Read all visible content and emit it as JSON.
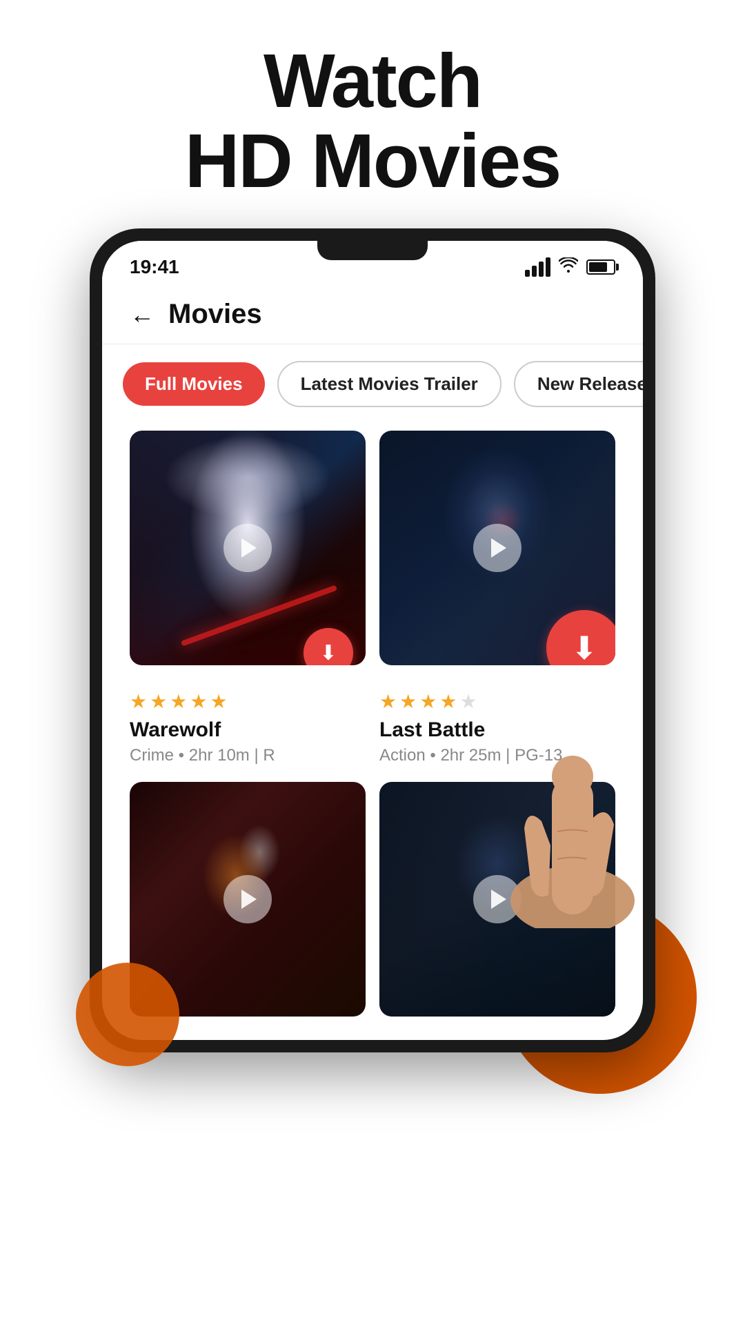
{
  "hero": {
    "title_line1": "Watch",
    "title_line2": "HD Movies"
  },
  "status_bar": {
    "time": "19:41"
  },
  "header": {
    "back_label": "←",
    "title": "Movies"
  },
  "tabs": [
    {
      "id": "full-movies",
      "label": "Full Movies",
      "active": true
    },
    {
      "id": "latest-trailer",
      "label": "Latest Movies Trailer",
      "active": false
    },
    {
      "id": "new-releases",
      "label": "New Releases",
      "active": false
    }
  ],
  "movies": [
    {
      "id": "warewolf",
      "title": "Warewolf",
      "genre": "Crime",
      "duration": "2hr 10m",
      "rating": "R",
      "stars": 5,
      "download": true,
      "download_large": false
    },
    {
      "id": "last-battle",
      "title": "Last Battle",
      "genre": "Action",
      "duration": "2hr 25m",
      "rating": "PG-13",
      "stars": 4,
      "download": true,
      "download_large": true
    },
    {
      "id": "movie3",
      "title": "",
      "genre": "",
      "duration": "",
      "rating": "",
      "stars": 0,
      "download": false,
      "download_large": false
    },
    {
      "id": "movie4",
      "title": "",
      "genre": "",
      "duration": "",
      "rating": "",
      "stars": 0,
      "download": false,
      "download_large": false
    }
  ]
}
